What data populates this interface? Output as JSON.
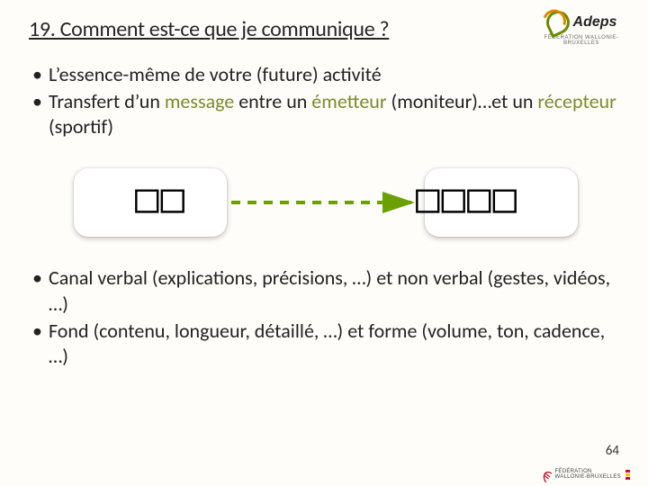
{
  "title": "19. Comment est-ce que je communique ?",
  "bullets_top": [
    {
      "segments": [
        {
          "text": "L’essence-même de votre (future) activité",
          "olive": false
        }
      ]
    },
    {
      "segments": [
        {
          "text": "Transfert d’un ",
          "olive": false
        },
        {
          "text": "message",
          "olive": true
        },
        {
          "text": " entre un ",
          "olive": false
        },
        {
          "text": "émetteur",
          "olive": true
        },
        {
          "text": " (moniteur)…et un ",
          "olive": false
        },
        {
          "text": "récepteur",
          "olive": true
        },
        {
          "text": " (sportif)",
          "olive": false
        }
      ]
    }
  ],
  "bullets_bottom": [
    {
      "segments": [
        {
          "text": "Canal verbal (explications, précisions, …) et non verbal (gestes, vidéos, …)",
          "olive": false
        }
      ]
    },
    {
      "segments": [
        {
          "text": "Fond (contenu, longueur, détaillé, …) et forme (volume, ton, cadence, …)",
          "olive": false
        }
      ]
    }
  ],
  "diagram": {
    "left_placeholder": "□□",
    "right_placeholder": "□□□□",
    "arrow_color": "#6aa000"
  },
  "logo_top": {
    "name": "Adeps",
    "sub": "FÉDÉRATION WALLONIE-BRUXELLES"
  },
  "logo_bottom": {
    "line1": "FÉDÉRATION",
    "line2": "WALLONIE-BRUXELLES"
  },
  "page_number": "64"
}
